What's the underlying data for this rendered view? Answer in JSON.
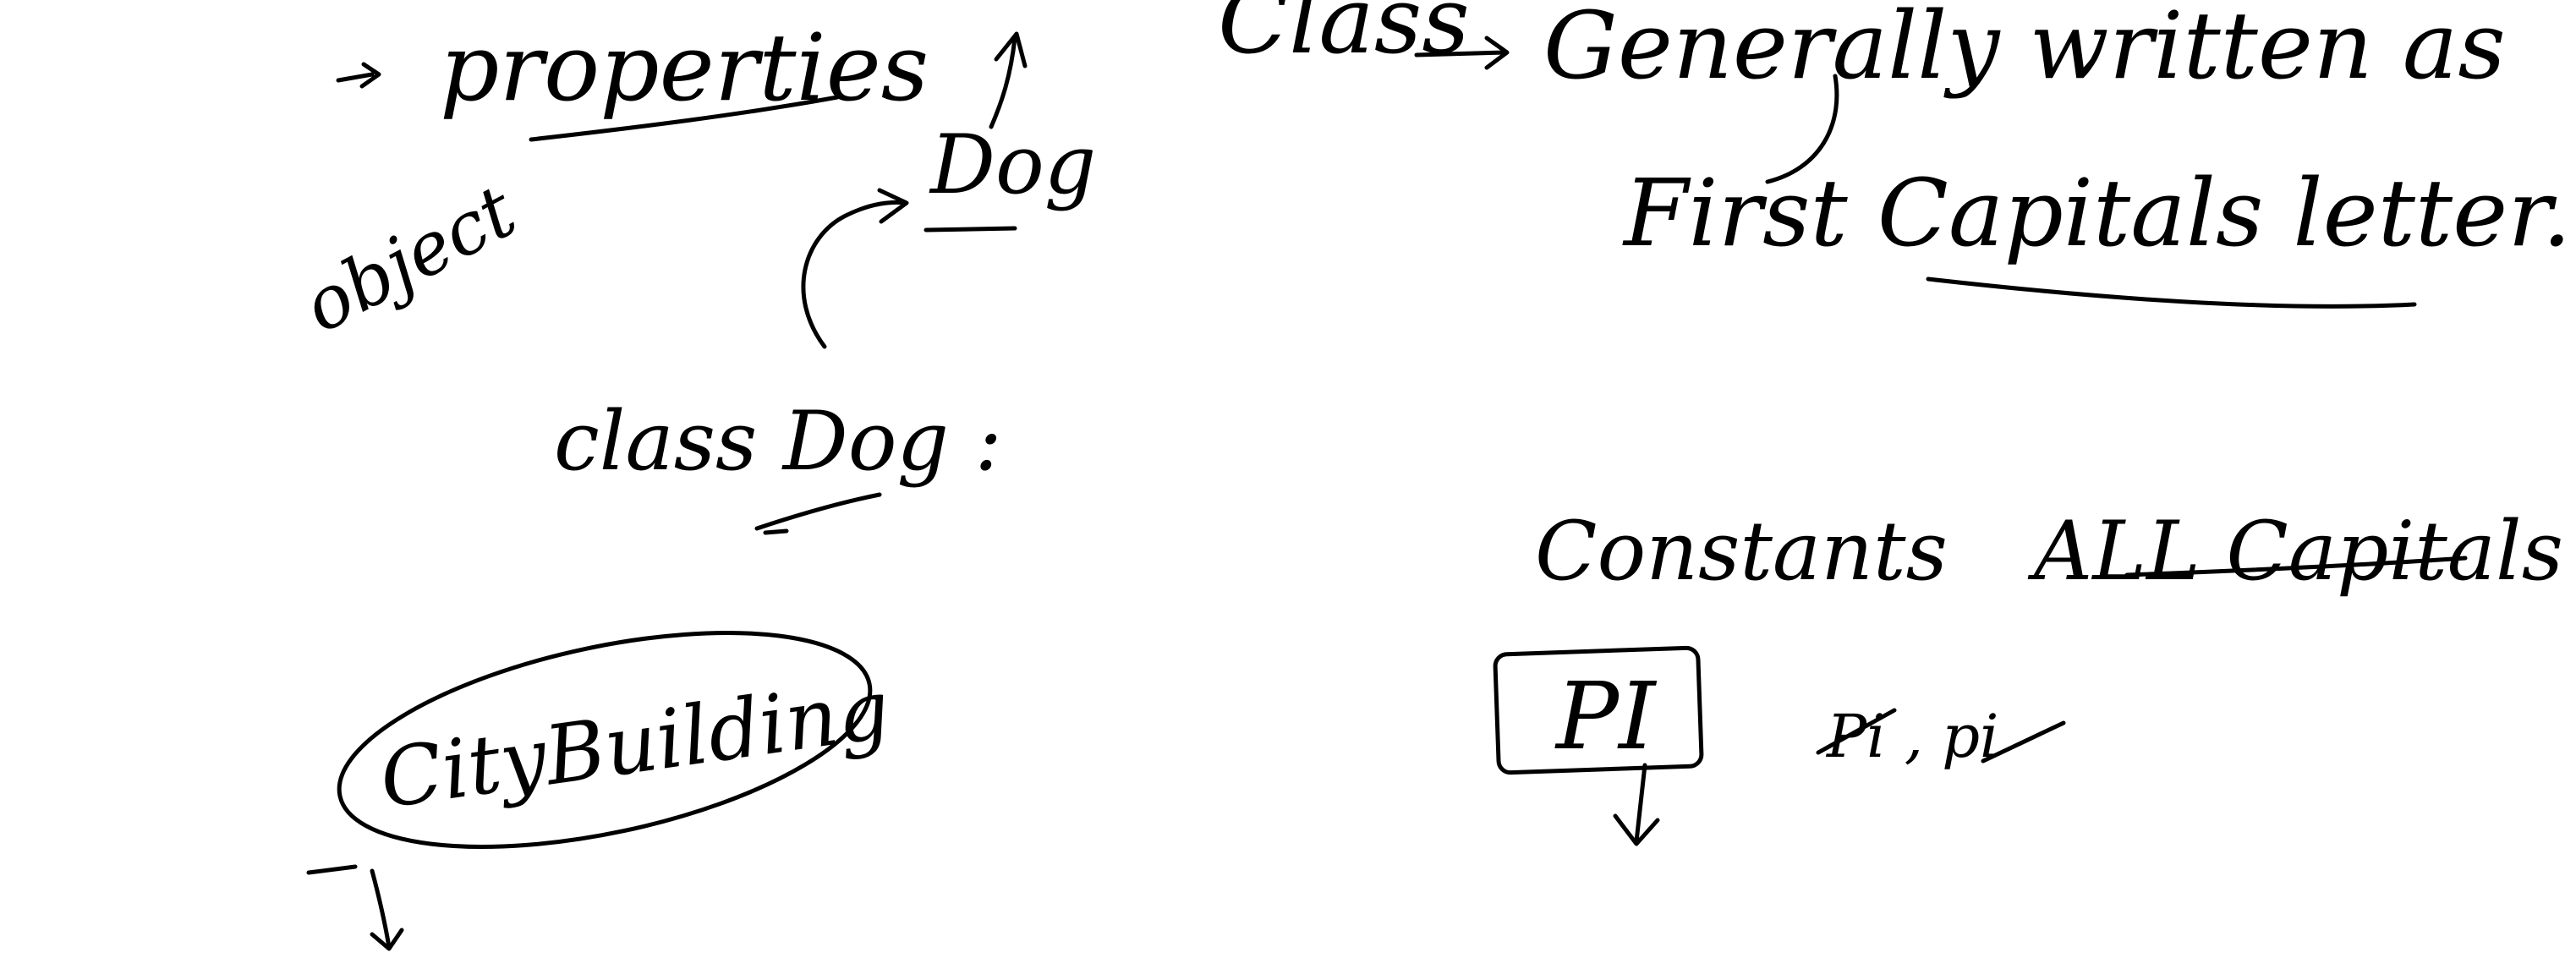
{
  "whiteboard": {
    "ink_color": "#000000",
    "background_color": "#ffffff",
    "left_notes": {
      "properties": "properties",
      "object": "object",
      "dog_top": "Dog",
      "class_dog": "class Dog :",
      "city_building": "CityBuilding"
    },
    "right_notes": {
      "class_label": "Class",
      "generally_written_as": "Generally written as",
      "first_capital_letter": "First Capitals letter.",
      "constants": "Constants",
      "all_capitals": "ALL Capitals",
      "pi": "PI",
      "pi_variants": "Pi , pi"
    }
  }
}
